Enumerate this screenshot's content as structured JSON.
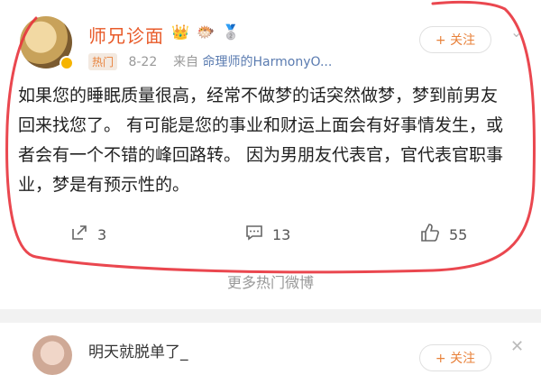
{
  "post": {
    "username": "师兄诊面",
    "badges": [
      "👑",
      "🐡",
      "🥈"
    ],
    "hot_tag": "热门",
    "date": "8-22",
    "source_prefix": "来自",
    "source": "命理师的HarmonyO...",
    "follow_label": "+ 关注",
    "content": "如果您的睡眠质量很高，经常不做梦的话突然做梦，梦到前男友回来找您了。 有可能是您的事业和财运上面会有好事情发生，或者会有一个不错的峰回路转。 因为男朋友代表官，官代表官职事业，梦是有预示性的。",
    "actions": {
      "share": {
        "icon": "share-icon",
        "count": "3"
      },
      "comment": {
        "icon": "comment-icon",
        "count": "13"
      },
      "like": {
        "icon": "like-icon",
        "count": "55"
      }
    }
  },
  "more_hot_label": "更多热门微博",
  "post2": {
    "username": "明天就脱单了_",
    "follow_label": "+ 关注"
  },
  "colors": {
    "username": "#e85b2a",
    "accent": "#e8813a",
    "annotation": "#e8333c"
  }
}
